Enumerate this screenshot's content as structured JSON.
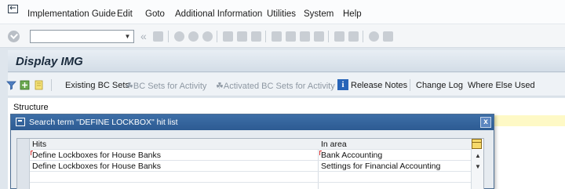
{
  "menubar": {
    "items": [
      "Implementation Guide",
      "Edit",
      "Goto",
      "Additional Information",
      "Utilities",
      "System",
      "Help"
    ],
    "icon": "menu-exit-icon"
  },
  "toolbar": {
    "command_field_value": "",
    "icons": [
      "save-icon",
      "back-icon",
      "exit-icon",
      "cancel-icon",
      "print-icon",
      "find-icon",
      "find-next-icon",
      "first-page-icon",
      "previous-page-icon",
      "next-page-icon",
      "last-page-icon",
      "new-session-icon",
      "shortcut-icon",
      "help-icon",
      "customize-layout-icon"
    ]
  },
  "title": "Display IMG",
  "app_toolbar": {
    "existing_bc_sets": "Existing BC Sets",
    "bc_sets_for_activity": "BC Sets for Activity",
    "activated_bc_sets": "Activated BC Sets for Activity",
    "release_notes": "Release Notes",
    "change_log": "Change Log",
    "where_else_used": "Where Else Used",
    "release_notes_icon_letter": "i"
  },
  "structure": {
    "label": "Structure"
  },
  "dialog": {
    "title": "Search term \"DEFINE LOCKBOX\" hit list",
    "close": "x",
    "columns": {
      "hits": "Hits",
      "area": "In area"
    },
    "rows": [
      {
        "hits": "Define Lockboxes for House Banks",
        "area": "Bank Accounting"
      },
      {
        "hits": "Define Lockboxes for House Banks",
        "area": "Settings for Financial Accounting"
      }
    ]
  },
  "colors": {
    "dialog_title": "#3d6ea7",
    "structure_highlight": "#fef9c6",
    "release_notes_icon": "#2764b8"
  }
}
